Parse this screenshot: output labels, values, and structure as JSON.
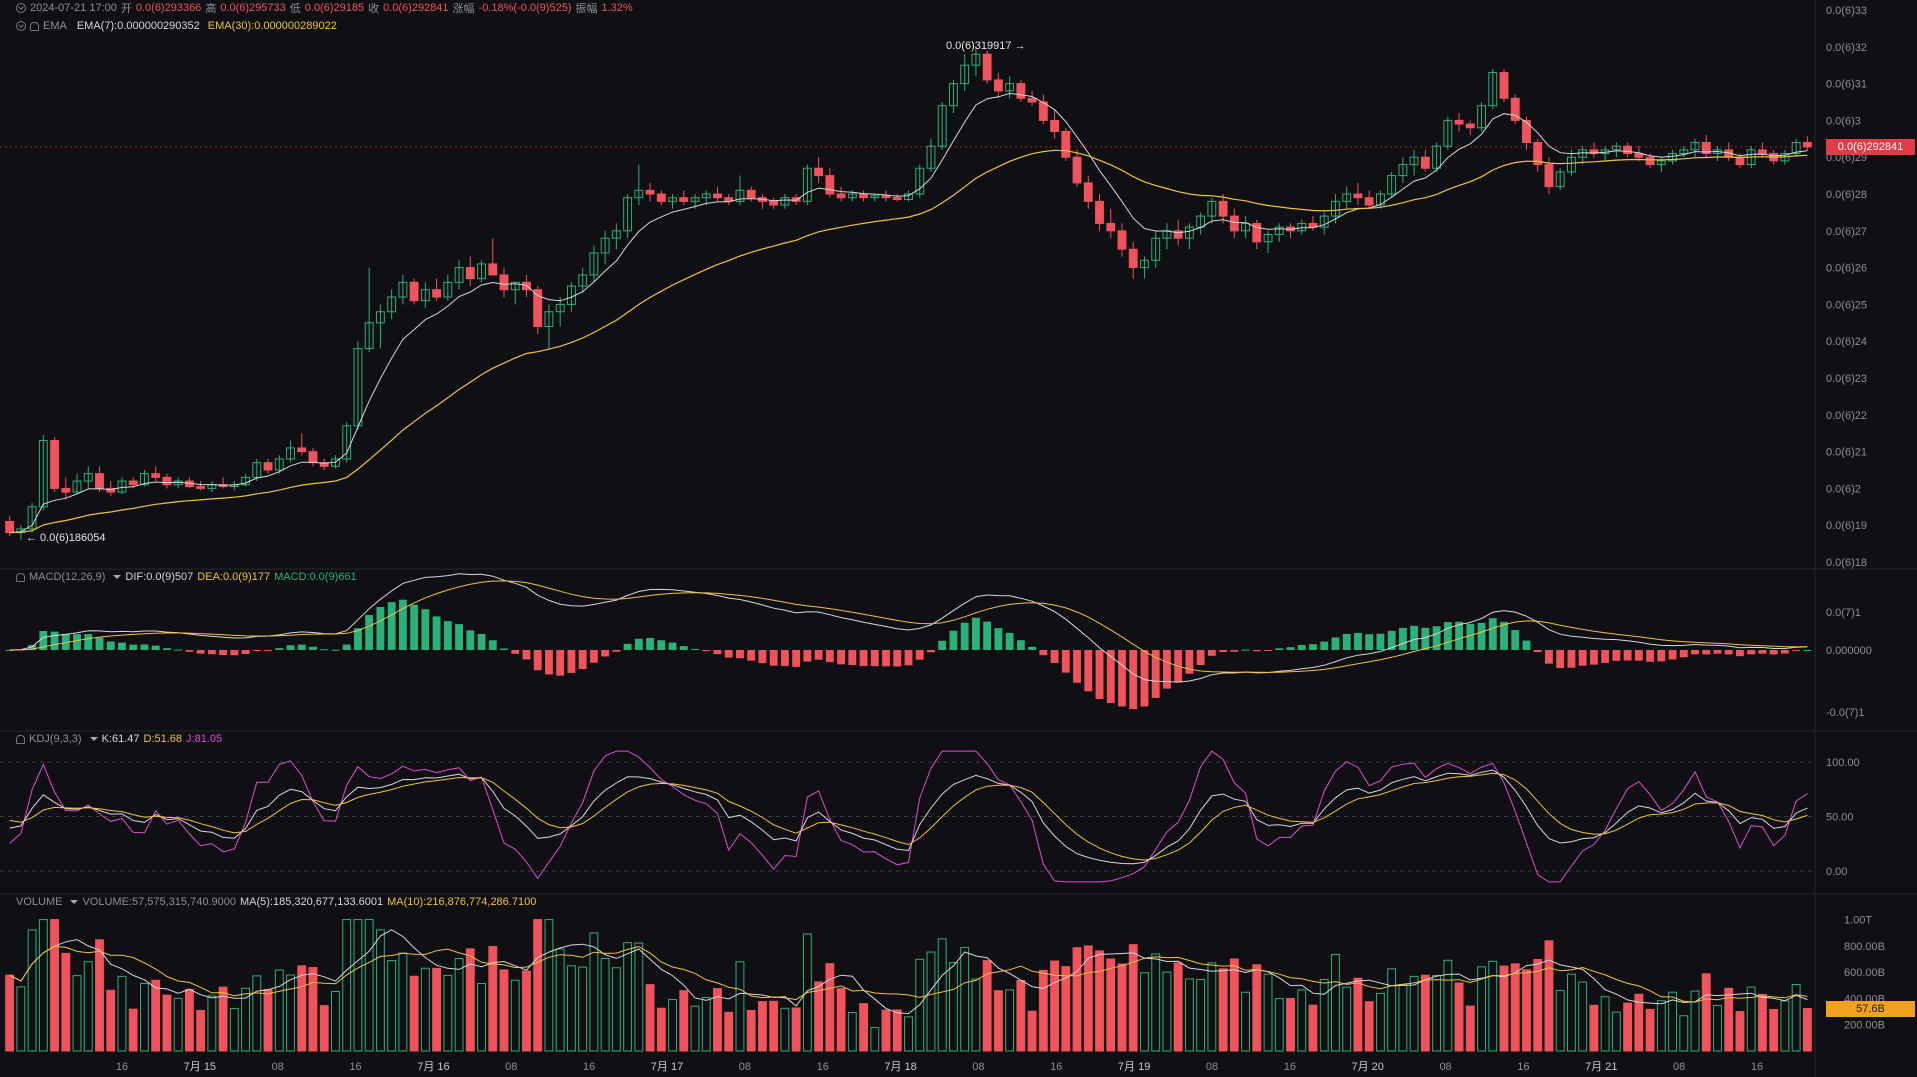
{
  "header": {
    "datetime": "2024-07-21 17:00",
    "open_label": "开",
    "open": "0.0(6)293366",
    "high_label": "高",
    "high": "0.0(6)295733",
    "low_label": "低",
    "low": "0.0(6)29185",
    "close_label": "收",
    "close": "0.0(6)292841",
    "change_label": "涨幅",
    "change": "-0.18%(-0.0(9)525)",
    "amp_label": "振幅",
    "amp": "1.32%"
  },
  "ema_legend": {
    "name": "EMA",
    "ema7": "EMA(7):0.000000290352",
    "ema30": "EMA(30):0.000000289022"
  },
  "macd_legend": {
    "name": "MACD(12,26,9)",
    "dif": "DIF:0.0(9)507",
    "dea": "DEA:0.0(9)177",
    "macd": "MACD:0.0(9)661"
  },
  "kdj_legend": {
    "name": "KDJ(9,3,3)",
    "k": "K:61.47",
    "d": "D:51.68",
    "j": "J:81.05"
  },
  "volume_legend": {
    "name": "VOLUME",
    "volume": "VOLUME:57,575,315,740.9000",
    "ma5": "MA(5):185,320,677,133.6001",
    "ma10": "MA(10):216,876,774,286.7100"
  },
  "price_axis": [
    "0.0(6)33",
    "0.0(6)32",
    "0.0(6)31",
    "0.0(6)3",
    "0.0(6)29",
    "0.0(6)28",
    "0.0(6)27",
    "0.0(6)26",
    "0.0(6)25",
    "0.0(6)24",
    "0.0(6)23",
    "0.0(6)22",
    "0.0(6)21",
    "0.0(6)2",
    "0.0(6)19",
    "0.0(6)18"
  ],
  "current_price_tag": "0.0(6)292841",
  "max_marker": "0.0(6)319917 →",
  "min_marker": "← 0.0(6)186054",
  "macd_axis": [
    "0.0(7)1",
    "0.000000",
    "-0.0(7)1"
  ],
  "kdj_axis": [
    "100.00",
    "50.00",
    "0.00"
  ],
  "volume_axis": [
    "1.00T",
    "800.00B",
    "600.00B",
    "400.00B",
    "200.00B"
  ],
  "volume_tag": "57.6B",
  "time_axis": [
    "16",
    "7月 15",
    "08",
    "16",
    "7月 16",
    "08",
    "16",
    "7月 17",
    "08",
    "16",
    "7月 18",
    "08",
    "16",
    "7月 19",
    "08",
    "16",
    "7月 20",
    "08",
    "16",
    "7月 21",
    "08",
    "16"
  ],
  "colors": {
    "up": "#2bb07a",
    "down": "#f0535b",
    "ema7": "#d6d7db",
    "ema30": "#f0c23b",
    "j_line": "#e04ccf",
    "background": "#101014"
  },
  "chart_data": {
    "type": "candlestick",
    "price_range": [
      1.8e-07,
      3.3e-07
    ],
    "candles": [
      [
        1.91e-07,
        1.925e-07,
        1.87e-07,
        1.88e-07
      ],
      [
        1.88e-07,
        1.9e-07,
        1.861e-07,
        1.89e-07
      ],
      [
        1.89e-07,
        1.96e-07,
        1.88e-07,
        1.95e-07
      ],
      [
        1.95e-07,
        2.145e-07,
        1.94e-07,
        2.13e-07
      ],
      [
        2.13e-07,
        2.14e-07,
        1.99e-07,
        2e-07
      ],
      [
        2e-07,
        2.03e-07,
        1.97e-07,
        1.99e-07
      ],
      [
        1.99e-07,
        2.04e-07,
        1.985e-07,
        2.02e-07
      ],
      [
        2.02e-07,
        2.06e-07,
        2e-07,
        2.04e-07
      ],
      [
        2.04e-07,
        2.06e-07,
        1.99e-07,
        2e-07
      ],
      [
        2e-07,
        2.02e-07,
        1.98e-07,
        1.99e-07
      ],
      [
        1.99e-07,
        2.03e-07,
        1.985e-07,
        2.02e-07
      ],
      [
        2.02e-07,
        2.03e-07,
        2e-07,
        2.01e-07
      ],
      [
        2.01e-07,
        2.05e-07,
        2.005e-07,
        2.04e-07
      ],
      [
        2.04e-07,
        2.06e-07,
        2.02e-07,
        2.03e-07
      ],
      [
        2.03e-07,
        2.04e-07,
        2e-07,
        2.01e-07
      ],
      [
        2.01e-07,
        2.03e-07,
        2e-07,
        2.02e-07
      ],
      [
        2.02e-07,
        2.03e-07,
        2e-07,
        2.005e-07
      ],
      [
        2.005e-07,
        2.02e-07,
        1.995e-07,
        2e-07
      ],
      [
        2e-07,
        2.02e-07,
        1.99e-07,
        2.01e-07
      ],
      [
        2.01e-07,
        2.03e-07,
        2e-07,
        2.005e-07
      ],
      [
        2.005e-07,
        2.02e-07,
        1.995e-07,
        2.01e-07
      ],
      [
        2.01e-07,
        2.04e-07,
        2.005e-07,
        2.03e-07
      ],
      [
        2.03e-07,
        2.08e-07,
        2.02e-07,
        2.07e-07
      ],
      [
        2.07e-07,
        2.08e-07,
        2.04e-07,
        2.05e-07
      ],
      [
        2.05e-07,
        2.09e-07,
        2.04e-07,
        2.08e-07
      ],
      [
        2.08e-07,
        2.13e-07,
        2.07e-07,
        2.11e-07
      ],
      [
        2.11e-07,
        2.15e-07,
        2.09e-07,
        2.1e-07
      ],
      [
        2.1e-07,
        2.11e-07,
        2.06e-07,
        2.07e-07
      ],
      [
        2.07e-07,
        2.08e-07,
        2.05e-07,
        2.06e-07
      ],
      [
        2.06e-07,
        2.09e-07,
        2.055e-07,
        2.08e-07
      ],
      [
        2.08e-07,
        2.18e-07,
        2.07e-07,
        2.17e-07
      ],
      [
        2.17e-07,
        2.4e-07,
        2.16e-07,
        2.38e-07
      ],
      [
        2.38e-07,
        2.6e-07,
        2.37e-07,
        2.45e-07
      ],
      [
        2.45e-07,
        2.5e-07,
        2.38e-07,
        2.48e-07
      ],
      [
        2.48e-07,
        2.54e-07,
        2.46e-07,
        2.52e-07
      ],
      [
        2.52e-07,
        2.58e-07,
        2.5e-07,
        2.56e-07
      ],
      [
        2.56e-07,
        2.57e-07,
        2.5e-07,
        2.51e-07
      ],
      [
        2.51e-07,
        2.56e-07,
        2.49e-07,
        2.54e-07
      ],
      [
        2.54e-07,
        2.57e-07,
        2.51e-07,
        2.52e-07
      ],
      [
        2.52e-07,
        2.58e-07,
        2.51e-07,
        2.56e-07
      ],
      [
        2.56e-07,
        2.62e-07,
        2.54e-07,
        2.6e-07
      ],
      [
        2.6e-07,
        2.63e-07,
        2.55e-07,
        2.57e-07
      ],
      [
        2.57e-07,
        2.62e-07,
        2.56e-07,
        2.61e-07
      ],
      [
        2.61e-07,
        2.68e-07,
        2.59e-07,
        2.58e-07
      ],
      [
        2.58e-07,
        2.6e-07,
        2.52e-07,
        2.54e-07
      ],
      [
        2.54e-07,
        2.56e-07,
        2.5e-07,
        2.56e-07
      ],
      [
        2.56e-07,
        2.58e-07,
        2.52e-07,
        2.54e-07
      ],
      [
        2.54e-07,
        2.55e-07,
        2.42e-07,
        2.44e-07
      ],
      [
        2.44e-07,
        2.5e-07,
        2.38e-07,
        2.48e-07
      ],
      [
        2.48e-07,
        2.52e-07,
        2.44e-07,
        2.5e-07
      ],
      [
        2.5e-07,
        2.56e-07,
        2.48e-07,
        2.55e-07
      ],
      [
        2.55e-07,
        2.6e-07,
        2.53e-07,
        2.58e-07
      ],
      [
        2.58e-07,
        2.66e-07,
        2.56e-07,
        2.64e-07
      ],
      [
        2.64e-07,
        2.7e-07,
        2.61e-07,
        2.68e-07
      ],
      [
        2.68e-07,
        2.72e-07,
        2.65e-07,
        2.7e-07
      ],
      [
        2.7e-07,
        2.8e-07,
        2.68e-07,
        2.79e-07
      ],
      [
        2.79e-07,
        2.88e-07,
        2.77e-07,
        2.81e-07
      ],
      [
        2.81e-07,
        2.83e-07,
        2.78e-07,
        2.8e-07
      ],
      [
        2.8e-07,
        2.81e-07,
        2.77e-07,
        2.78e-07
      ],
      [
        2.78e-07,
        2.8e-07,
        2.76e-07,
        2.79e-07
      ],
      [
        2.79e-07,
        2.81e-07,
        2.77e-07,
        2.78e-07
      ],
      [
        2.78e-07,
        2.8e-07,
        2.76e-07,
        2.79e-07
      ],
      [
        2.79e-07,
        2.81e-07,
        2.77e-07,
        2.8e-07
      ],
      [
        2.8e-07,
        2.82e-07,
        2.78e-07,
        2.79e-07
      ],
      [
        2.79e-07,
        2.8e-07,
        2.77e-07,
        2.78e-07
      ],
      [
        2.78e-07,
        2.85e-07,
        2.77e-07,
        2.81e-07
      ],
      [
        2.81e-07,
        2.82e-07,
        2.78e-07,
        2.79e-07
      ],
      [
        2.79e-07,
        2.8e-07,
        2.76e-07,
        2.78e-07
      ],
      [
        2.78e-07,
        2.79e-07,
        2.76e-07,
        2.77e-07
      ],
      [
        2.77e-07,
        2.8e-07,
        2.76e-07,
        2.79e-07
      ],
      [
        2.79e-07,
        2.8e-07,
        2.77e-07,
        2.78e-07
      ],
      [
        2.78e-07,
        2.88e-07,
        2.77e-07,
        2.87e-07
      ],
      [
        2.87e-07,
        2.9e-07,
        2.83e-07,
        2.85e-07
      ],
      [
        2.85e-07,
        2.87e-07,
        2.79e-07,
        2.8e-07
      ],
      [
        2.8e-07,
        2.82e-07,
        2.78e-07,
        2.79e-07
      ],
      [
        2.79e-07,
        2.81e-07,
        2.78e-07,
        2.8e-07
      ],
      [
        2.8e-07,
        2.81e-07,
        2.78e-07,
        2.79e-07
      ],
      [
        2.79e-07,
        2.8e-07,
        2.78e-07,
        2.795e-07
      ],
      [
        2.795e-07,
        2.81e-07,
        2.78e-07,
        2.79e-07
      ],
      [
        2.79e-07,
        2.8e-07,
        2.78e-07,
        2.785e-07
      ],
      [
        2.785e-07,
        2.81e-07,
        2.78e-07,
        2.8e-07
      ],
      [
        2.8e-07,
        2.88e-07,
        2.79e-07,
        2.87e-07
      ],
      [
        2.87e-07,
        2.95e-07,
        2.86e-07,
        2.93e-07
      ],
      [
        2.93e-07,
        3.05e-07,
        2.92e-07,
        3.04e-07
      ],
      [
        3.04e-07,
        3.11e-07,
        3.02e-07,
        3.1e-07
      ],
      [
        3.1e-07,
        3.18e-07,
        3.08e-07,
        3.15e-07
      ],
      [
        3.15e-07,
        3.199e-07,
        3.12e-07,
        3.18e-07
      ],
      [
        3.18e-07,
        3.19e-07,
        3.1e-07,
        3.11e-07
      ],
      [
        3.11e-07,
        3.13e-07,
        3.06e-07,
        3.08e-07
      ],
      [
        3.08e-07,
        3.12e-07,
        3.06e-07,
        3.1e-07
      ],
      [
        3.1e-07,
        3.11e-07,
        3.05e-07,
        3.06e-07
      ],
      [
        3.06e-07,
        3.08e-07,
        3.04e-07,
        3.05e-07
      ],
      [
        3.05e-07,
        3.07e-07,
        2.99e-07,
        3e-07
      ],
      [
        3e-07,
        3.03e-07,
        2.95e-07,
        2.97e-07
      ],
      [
        2.97e-07,
        2.98e-07,
        2.89e-07,
        2.9e-07
      ],
      [
        2.9e-07,
        2.92e-07,
        2.82e-07,
        2.83e-07
      ],
      [
        2.83e-07,
        2.85e-07,
        2.76e-07,
        2.78e-07
      ],
      [
        2.78e-07,
        2.8e-07,
        2.7e-07,
        2.72e-07
      ],
      [
        2.72e-07,
        2.76e-07,
        2.68e-07,
        2.7e-07
      ],
      [
        2.7e-07,
        2.72e-07,
        2.63e-07,
        2.65e-07
      ],
      [
        2.65e-07,
        2.67e-07,
        2.57e-07,
        2.6e-07
      ],
      [
        2.6e-07,
        2.63e-07,
        2.57e-07,
        2.62e-07
      ],
      [
        2.62e-07,
        2.7e-07,
        2.6e-07,
        2.68e-07
      ],
      [
        2.68e-07,
        2.72e-07,
        2.65e-07,
        2.7e-07
      ],
      [
        2.7e-07,
        2.73e-07,
        2.66e-07,
        2.68e-07
      ],
      [
        2.68e-07,
        2.72e-07,
        2.65e-07,
        2.71e-07
      ],
      [
        2.71e-07,
        2.75e-07,
        2.69e-07,
        2.74e-07
      ],
      [
        2.74e-07,
        2.79e-07,
        2.72e-07,
        2.78e-07
      ],
      [
        2.78e-07,
        2.8e-07,
        2.72e-07,
        2.74e-07
      ],
      [
        2.74e-07,
        2.76e-07,
        2.68e-07,
        2.7e-07
      ],
      [
        2.7e-07,
        2.74e-07,
        2.68e-07,
        2.72e-07
      ],
      [
        2.72e-07,
        2.73e-07,
        2.65e-07,
        2.67e-07
      ],
      [
        2.67e-07,
        2.7e-07,
        2.64e-07,
        2.69e-07
      ],
      [
        2.69e-07,
        2.72e-07,
        2.67e-07,
        2.71e-07
      ],
      [
        2.71e-07,
        2.72e-07,
        2.68e-07,
        2.7e-07
      ],
      [
        2.7e-07,
        2.73e-07,
        2.69e-07,
        2.72e-07
      ],
      [
        2.72e-07,
        2.74e-07,
        2.7e-07,
        2.71e-07
      ],
      [
        2.71e-07,
        2.75e-07,
        2.69e-07,
        2.74e-07
      ],
      [
        2.74e-07,
        2.8e-07,
        2.72e-07,
        2.78e-07
      ],
      [
        2.78e-07,
        2.82e-07,
        2.76e-07,
        2.8e-07
      ],
      [
        2.8e-07,
        2.83e-07,
        2.77e-07,
        2.79e-07
      ],
      [
        2.79e-07,
        2.81e-07,
        2.76e-07,
        2.77e-07
      ],
      [
        2.77e-07,
        2.81e-07,
        2.76e-07,
        2.8e-07
      ],
      [
        2.8e-07,
        2.86e-07,
        2.79e-07,
        2.85e-07
      ],
      [
        2.85e-07,
        2.9e-07,
        2.83e-07,
        2.88e-07
      ],
      [
        2.88e-07,
        2.92e-07,
        2.85e-07,
        2.9e-07
      ],
      [
        2.9e-07,
        2.92e-07,
        2.86e-07,
        2.87e-07
      ],
      [
        2.87e-07,
        2.94e-07,
        2.86e-07,
        2.93e-07
      ],
      [
        2.93e-07,
        3.01e-07,
        2.92e-07,
        3e-07
      ],
      [
        3e-07,
        3.02e-07,
        2.97e-07,
        2.99e-07
      ],
      [
        2.99e-07,
        3e-07,
        2.96e-07,
        2.98e-07
      ],
      [
        2.98e-07,
        3.05e-07,
        2.97e-07,
        3.04e-07
      ],
      [
        3.04e-07,
        3.14e-07,
        3.03e-07,
        3.13e-07
      ],
      [
        3.13e-07,
        3.14e-07,
        3.05e-07,
        3.06e-07
      ],
      [
        3.06e-07,
        3.07e-07,
        2.99e-07,
        3e-07
      ],
      [
        3e-07,
        3.01e-07,
        2.92e-07,
        2.94e-07
      ],
      [
        2.94e-07,
        2.95e-07,
        2.86e-07,
        2.88e-07
      ],
      [
        2.88e-07,
        2.9e-07,
        2.8e-07,
        2.82e-07
      ],
      [
        2.82e-07,
        2.87e-07,
        2.81e-07,
        2.86e-07
      ],
      [
        2.86e-07,
        2.92e-07,
        2.85e-07,
        2.9e-07
      ],
      [
        2.9e-07,
        2.93e-07,
        2.88e-07,
        2.92e-07
      ],
      [
        2.92e-07,
        2.94e-07,
        2.9e-07,
        2.91e-07
      ],
      [
        2.91e-07,
        2.93e-07,
        2.89e-07,
        2.92e-07
      ],
      [
        2.92e-07,
        2.94e-07,
        2.9e-07,
        2.93e-07
      ],
      [
        2.93e-07,
        2.94e-07,
        2.9e-07,
        2.91e-07
      ],
      [
        2.91e-07,
        2.93e-07,
        2.89e-07,
        2.9e-07
      ],
      [
        2.9e-07,
        2.91e-07,
        2.87e-07,
        2.88e-07
      ],
      [
        2.88e-07,
        2.9e-07,
        2.86e-07,
        2.89e-07
      ],
      [
        2.89e-07,
        2.92e-07,
        2.88e-07,
        2.91e-07
      ],
      [
        2.91e-07,
        2.93e-07,
        2.9e-07,
        2.92e-07
      ],
      [
        2.92e-07,
        2.95e-07,
        2.9e-07,
        2.94e-07
      ],
      [
        2.94e-07,
        2.96e-07,
        2.9e-07,
        2.91e-07
      ],
      [
        2.91e-07,
        2.93e-07,
        2.89e-07,
        2.92e-07
      ],
      [
        2.92e-07,
        2.94e-07,
        2.89e-07,
        2.9e-07
      ],
      [
        2.9e-07,
        2.91e-07,
        2.87e-07,
        2.88e-07
      ],
      [
        2.88e-07,
        2.93e-07,
        2.87e-07,
        2.92e-07
      ],
      [
        2.92e-07,
        2.94e-07,
        2.9e-07,
        2.91e-07
      ],
      [
        2.91e-07,
        2.92e-07,
        2.88e-07,
        2.89e-07
      ],
      [
        2.89e-07,
        2.92e-07,
        2.88e-07,
        2.91e-07
      ],
      [
        2.91e-07,
        2.95e-07,
        2.9e-07,
        2.94e-07
      ],
      [
        2.94e-07,
        2.957e-07,
        2.918e-07,
        2.928e-07
      ]
    ],
    "ema7_label": "EMA(7)",
    "ema30_label": "EMA(30)",
    "max_price": 3.19917e-07,
    "min_price": 1.86054e-07
  }
}
